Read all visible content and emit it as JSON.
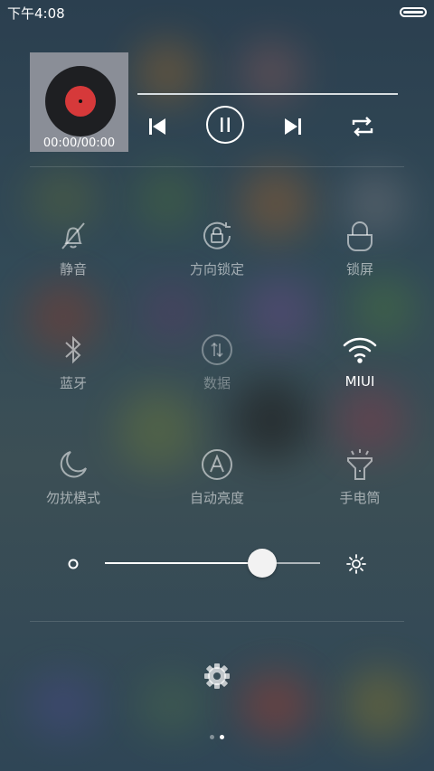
{
  "status_bar": {
    "time": "下午4:08"
  },
  "player": {
    "time_display": "00:00/00:00",
    "progress_fraction": 0.0
  },
  "toggles": [
    {
      "label": "静音",
      "state": "off",
      "icon": "bell-muted-icon"
    },
    {
      "label": "方向锁定",
      "state": "off",
      "icon": "rotation-lock-icon"
    },
    {
      "label": "锁屏",
      "state": "off",
      "icon": "lock-icon"
    },
    {
      "label": "蓝牙",
      "state": "off",
      "icon": "bluetooth-icon"
    },
    {
      "label": "数据",
      "state": "disabled",
      "icon": "mobile-data-icon"
    },
    {
      "label": "MIUI",
      "state": "on",
      "icon": "wifi-icon"
    },
    {
      "label": "勿扰模式",
      "state": "off",
      "icon": "moon-icon"
    },
    {
      "label": "自动亮度",
      "state": "off",
      "icon": "auto-brightness-icon"
    },
    {
      "label": "手电筒",
      "state": "off",
      "icon": "flashlight-icon"
    }
  ],
  "brightness": {
    "level_fraction": 0.73
  },
  "pager": {
    "count": 2,
    "active": 1
  },
  "colors": {
    "accent": "#ffffff",
    "dim": "rgba(255,255,255,0.55)"
  }
}
